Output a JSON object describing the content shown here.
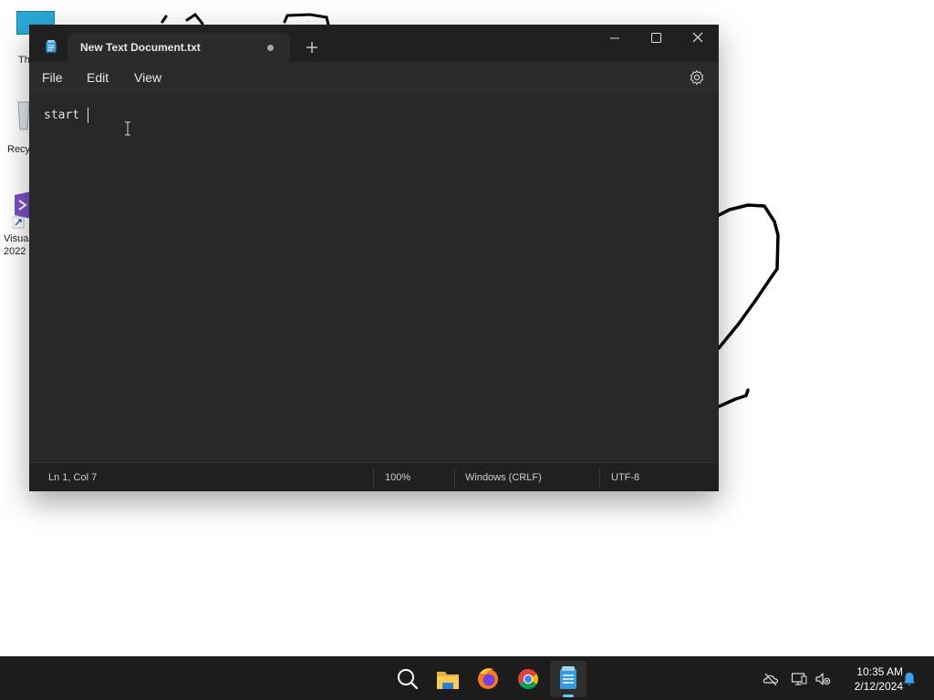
{
  "desktop": {
    "icons": [
      {
        "name": "this-pc",
        "label": "Th"
      },
      {
        "name": "recycle-bin",
        "label": "Recy"
      },
      {
        "name": "visual-studio",
        "label": "Visua",
        "label2": "2022"
      }
    ]
  },
  "window": {
    "tab_title": "New Text Document.txt",
    "tab_modified": true,
    "menu": {
      "file": "File",
      "edit": "Edit",
      "view": "View"
    },
    "editor_text": "start ",
    "status": {
      "position": "Ln 1, Col 7",
      "zoom": "100%",
      "line_endings": "Windows (CRLF)",
      "encoding": "UTF-8"
    }
  },
  "taskbar": {
    "apps": [
      "search-icon",
      "file-explorer-icon",
      "firefox-icon",
      "chrome-icon",
      "notepad-icon"
    ],
    "active_app": "notepad-icon",
    "time": "10:35 AM",
    "date": "2/12/2024"
  },
  "colors": {
    "window_bg": "#202020",
    "editor_bg": "#272727",
    "accent": "#60cdff",
    "notepad_icon": "#3a9ad9"
  }
}
